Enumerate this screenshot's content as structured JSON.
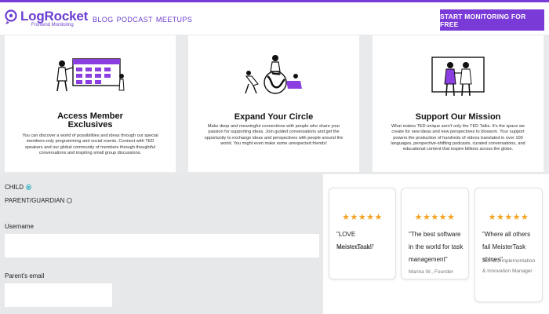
{
  "header": {
    "brand": "LogRocket",
    "brand_sub": "Frontend Monitoring",
    "nav": [
      "BLOG",
      "PODCAST",
      "MEETUPS"
    ],
    "cta": "START MONITORING FOR FREE",
    "accent": "#7a3ad8"
  },
  "cards": [
    {
      "title_line1": "Access Member",
      "title_line2": "Exclusives",
      "body": "You can discover a world of possibilities and ideas through our special members-only programming and social events. Connect with TED speakers and our global community of members through thoughtful conversations and inspiring small group discussions."
    },
    {
      "title_line1": "Expand Your Circle",
      "body": "Make deep and meaningful connections with people who share your passion for supporting ideas. Join guided conversations and get the opportunity to exchange ideas and perspectives with people around the world. You might even make some unexpected friends!"
    },
    {
      "title_line1": "Support Our Mission",
      "body": "What makes TED unique aren't only the TED Talks. It's the space we create for new ideas and new perspectives to blossom. Your support powers the production of hundreds of videos translated in over 100 languages, perspective-shifting podcasts, curated conversations, and educational content that inspire billions across the globe."
    }
  ],
  "form": {
    "radio_child": "CHILD",
    "radio_parent": "PARENT/GUARDIAN",
    "username_label": "Username",
    "parent_email_label": "Parent's email"
  },
  "testimonials": [
    {
      "stars": "★★★★★",
      "quote": "\"LOVE MeisterTask!\"",
      "author": "Matt H., Director"
    },
    {
      "stars": "★★★★★",
      "quote": "\"The best software in the world for task management\"",
      "author": "Marina W., Founder"
    },
    {
      "stars": "★★★★★",
      "quote": "\"Where all others fail MeisterTask shines\"",
      "author": "Jon G., Implementation & Innovation Manager"
    }
  ]
}
